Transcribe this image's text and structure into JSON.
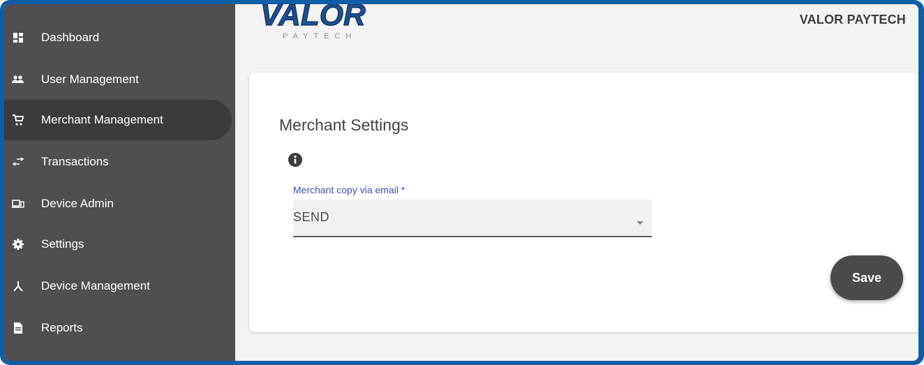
{
  "sidebar": {
    "items": [
      {
        "label": "Dashboard",
        "icon": "dashboard-icon"
      },
      {
        "label": "User Management",
        "icon": "people-icon"
      },
      {
        "label": "Merchant Management",
        "icon": "cart-icon",
        "active": true
      },
      {
        "label": "Transactions",
        "icon": "swap-arrows-icon"
      },
      {
        "label": "Device Admin",
        "icon": "devices-icon"
      },
      {
        "label": "Settings",
        "icon": "gear-icon"
      },
      {
        "label": "Device Management",
        "icon": "network-icon"
      },
      {
        "label": "Reports",
        "icon": "document-icon"
      }
    ]
  },
  "header": {
    "logo_text": "VALOR",
    "logo_subtext": "PAYTECH",
    "brand": "VALOR PAYTECH"
  },
  "card": {
    "title": "Merchant Settings",
    "info_icon": "info-icon",
    "field_label": "Merchant copy via email *",
    "field_value": "SEND",
    "save_label": "Save"
  },
  "colors": {
    "frame": "#0f5ea8",
    "sidebar": "#4f4f4f",
    "sidebar_active": "#3b3b3b",
    "field_label": "#3f51b5",
    "button": "#4a4a4a"
  }
}
